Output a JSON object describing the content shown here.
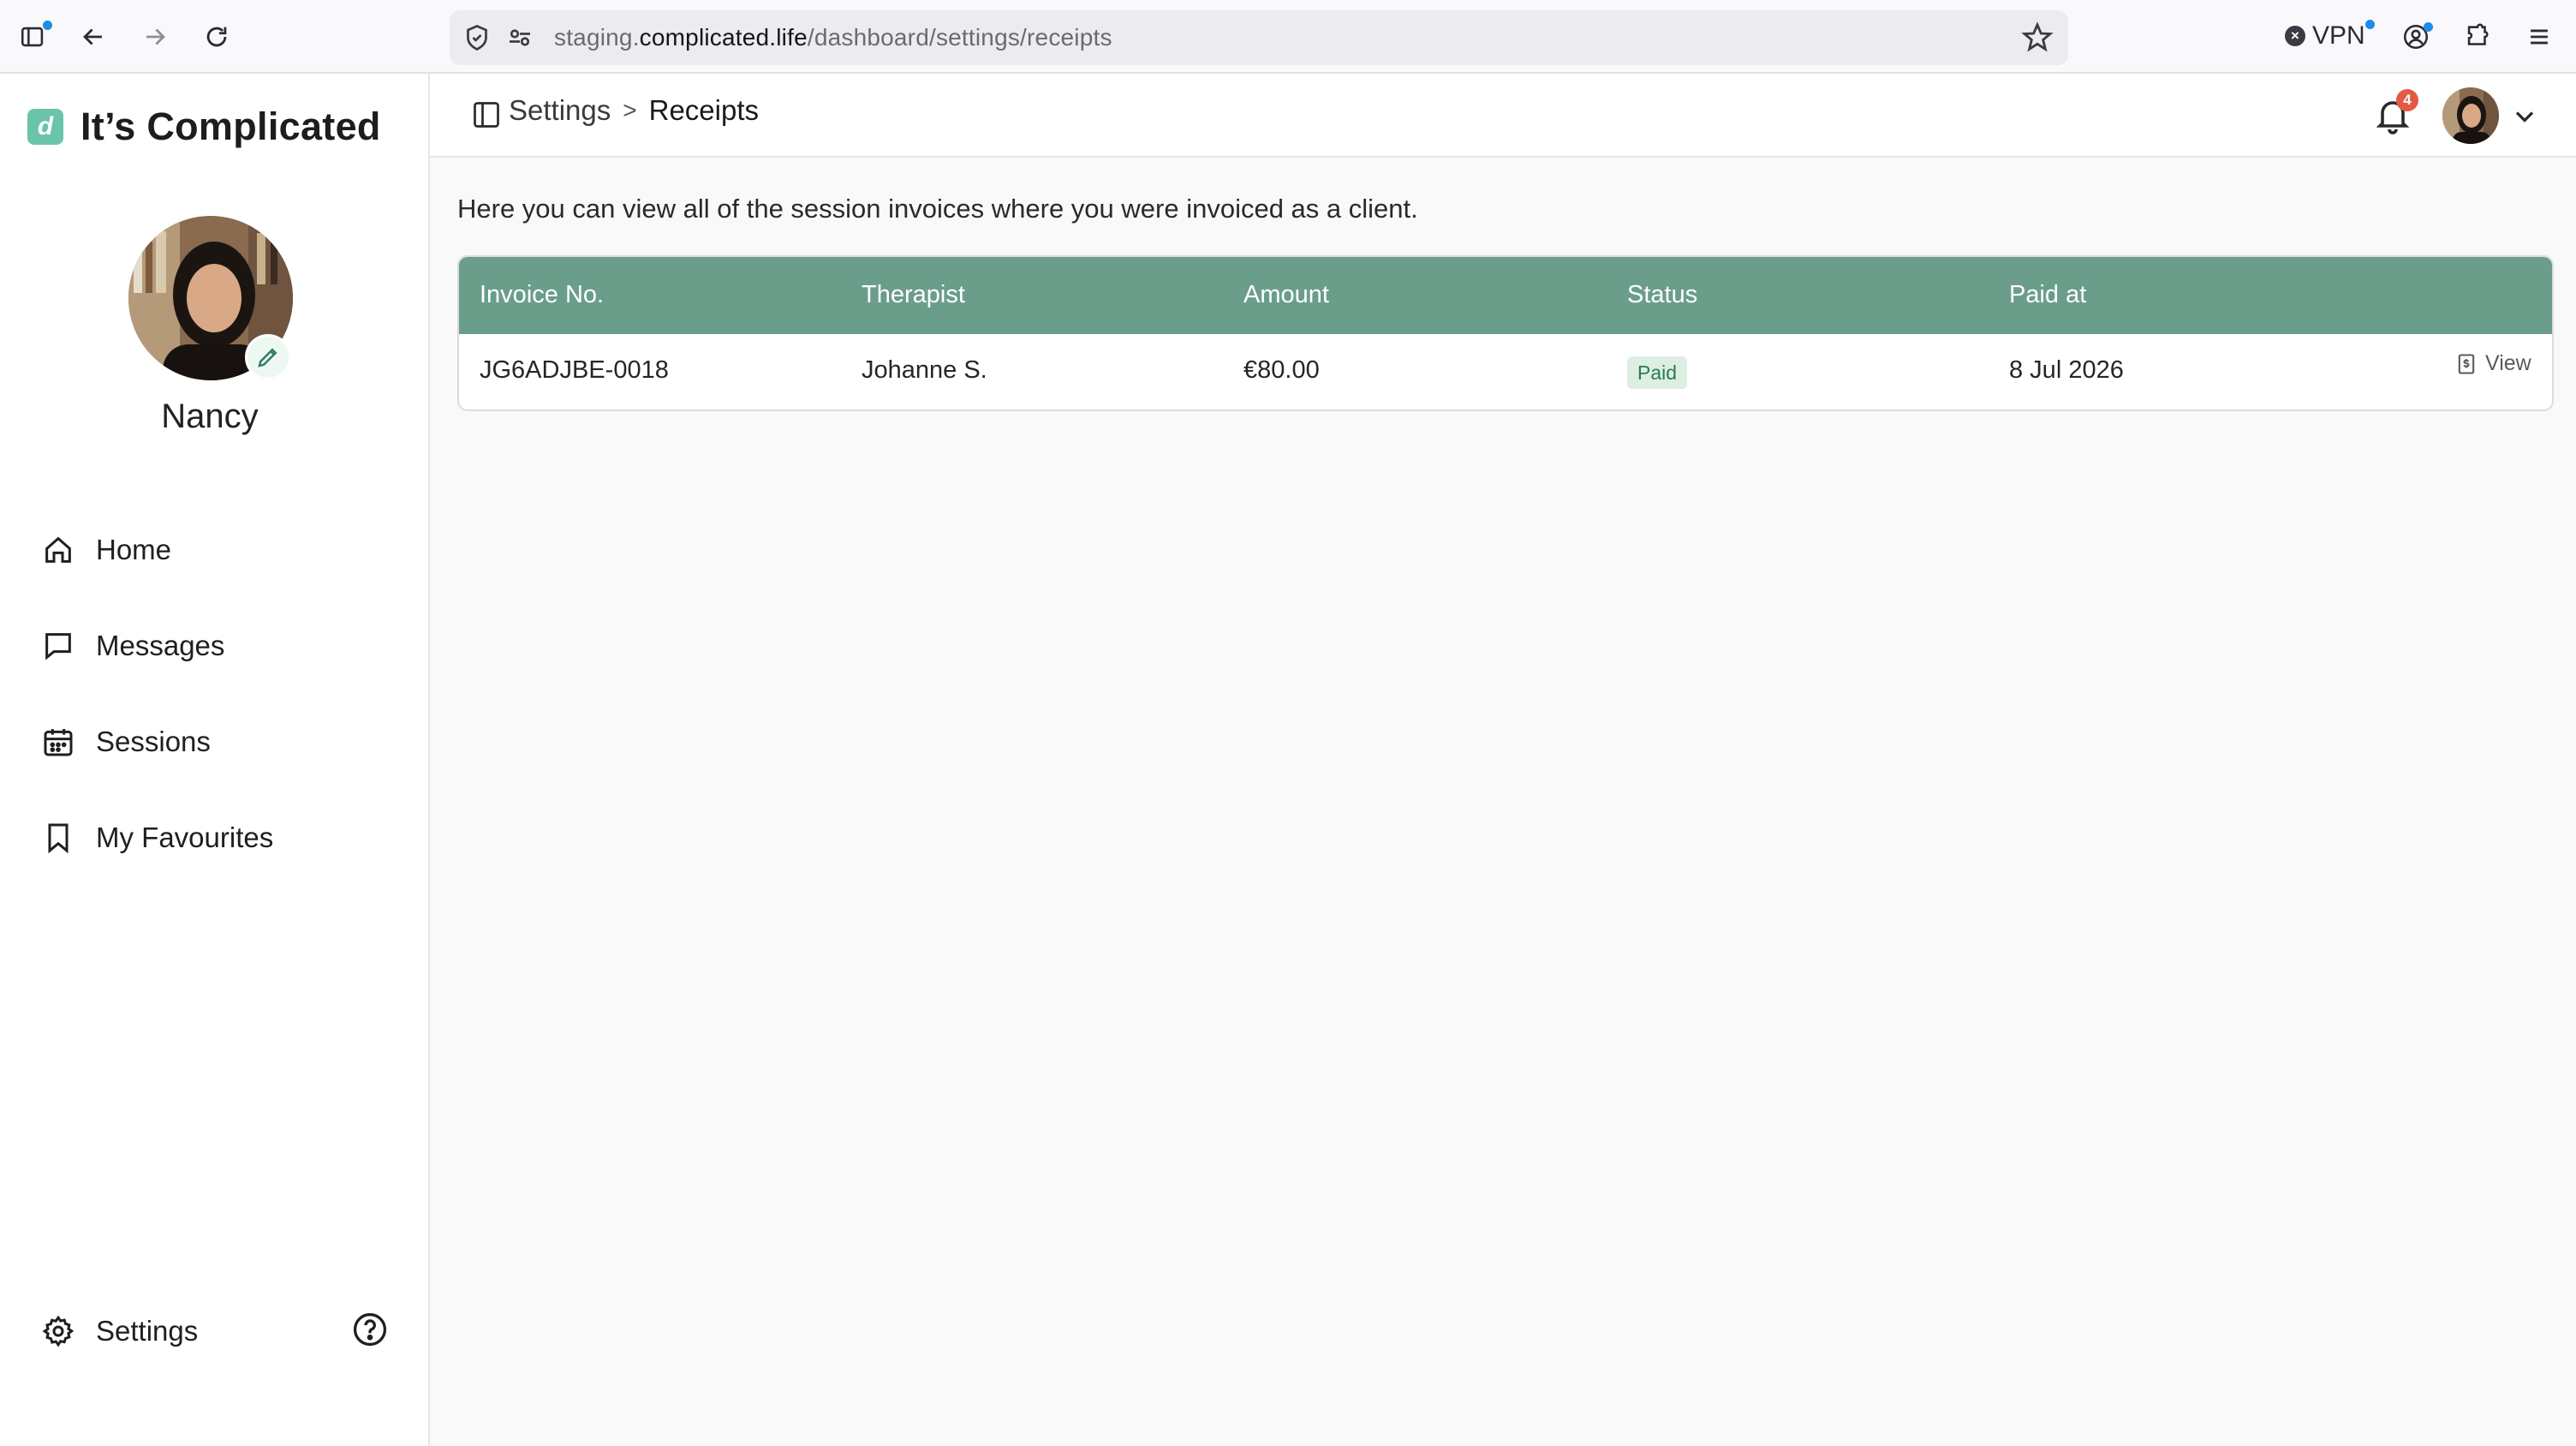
{
  "browser": {
    "url_prefix": "staging.",
    "url_host": "complicated.life",
    "url_path": "/dashboard/settings/receipts",
    "vpn_label": "VPN"
  },
  "app": {
    "logo_letter": "d",
    "name": "It’s Complicated",
    "accent_color": "#6b9e8a"
  },
  "profile": {
    "name": "Nancy"
  },
  "sidebar": {
    "items": [
      {
        "label": "Home",
        "icon": "home-icon"
      },
      {
        "label": "Messages",
        "icon": "message-icon"
      },
      {
        "label": "Sessions",
        "icon": "calendar-icon"
      },
      {
        "label": "My Favourites",
        "icon": "bookmark-icon"
      }
    ],
    "settings_label": "Settings"
  },
  "header": {
    "breadcrumb_parent": "Settings",
    "breadcrumb_separator": ">",
    "breadcrumb_current": "Receipts",
    "notification_count": "4"
  },
  "main": {
    "intro": "Here you can view all of the session invoices where you were invoiced as a client.",
    "table": {
      "columns": [
        "Invoice No.",
        "Therapist",
        "Amount",
        "Status",
        "Paid at"
      ],
      "rows": [
        {
          "invoice_no": "JG6ADJBE-0018",
          "therapist": "Johanne S.",
          "amount": "€80.00",
          "status": "Paid",
          "paid_at": "8 Jul 2026",
          "action": "View"
        }
      ]
    }
  }
}
